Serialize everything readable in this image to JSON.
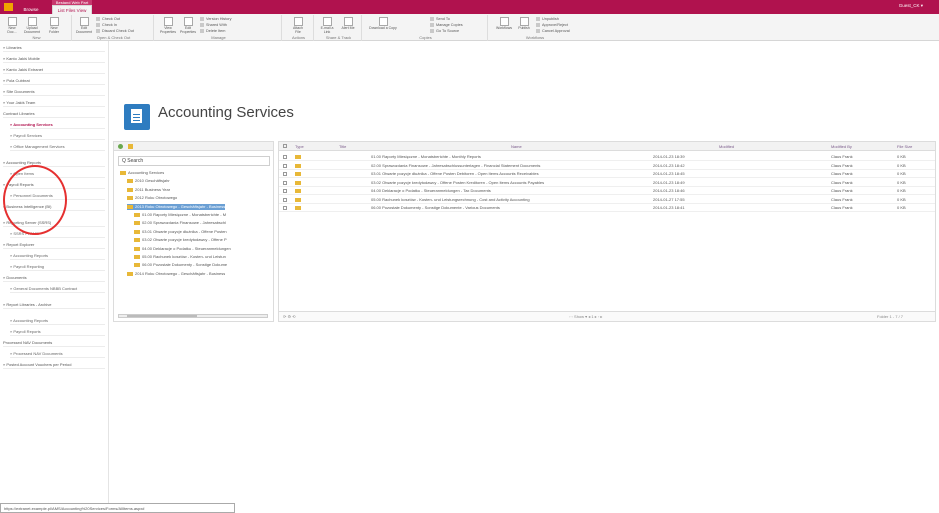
{
  "topbar": {
    "context_tab": "Bestand Web Part",
    "tab_browse": "Browse",
    "tab_list": "List Files View",
    "user": "Guest_CK ▾",
    "accent": "#b0124e"
  },
  "ribbon": {
    "groups": [
      "New",
      "Open & Check Out",
      "Manage",
      "Actions",
      "Share & Track",
      "Copies",
      "Workflows"
    ],
    "new": {
      "new_label": "New Doc...",
      "upload_label": "Upload Document",
      "folder_label": "New Folder"
    },
    "open": {
      "edit_label": "Edit Document",
      "check_out": "Check Out",
      "check_in": "Check In",
      "discard": "Discard Check Out"
    },
    "manage": {
      "view": "View Properties",
      "edit": "Edit Properties",
      "version_history": "Version History",
      "shared_with": "Shared With",
      "delete": "Delete Item"
    },
    "actions": {
      "attach": "Attach File"
    },
    "share": {
      "email": "E-mail a Link",
      "alert": "Alert Me"
    },
    "copies": {
      "download": "Download a Copy",
      "send_to": "Send To",
      "manage_copies": "Manage Copies",
      "go_to_source": "Go To Source"
    },
    "workflows": {
      "workflows": "Workflows",
      "publish": "Publish",
      "unpublish": "Unpublish",
      "approve": "Approve/Reject",
      "cancel": "Cancel Approval"
    }
  },
  "leftnav": {
    "items": [
      {
        "label": "» Libraries",
        "sub": false
      },
      {
        "label": "» Kanto Jakiś Mobile",
        "sub": false
      },
      {
        "label": "» Kanto Jakiś Extranet",
        "sub": false
      },
      {
        "label": "» Pola Cubbrat",
        "sub": false
      },
      {
        "label": "» Site Documents",
        "sub": false
      },
      {
        "label": "» Your Jakiś Team",
        "sub": false
      },
      {
        "label": "Contract Libraries",
        "sub": false
      },
      {
        "label": "» Accounting Services",
        "sub": true,
        "active": true
      },
      {
        "label": "» Payroll Services",
        "sub": true
      },
      {
        "label": "» Office Management Services",
        "sub": true
      },
      {
        "label": "» Accounting Reports",
        "sub": false
      },
      {
        "label": "» Open Items",
        "sub": true
      },
      {
        "label": "» Payroll Reports",
        "sub": false
      },
      {
        "label": "» Personnel Documents",
        "sub": true
      },
      {
        "label": "» Business Intelligence (BI)",
        "sub": false
      },
      {
        "label": "» Reporting Server (SSRS)",
        "sub": false
      },
      {
        "label": "» SSRS PFAME",
        "sub": true
      },
      {
        "label": "» Report Explorer",
        "sub": false
      },
      {
        "label": "» Accounting Reports",
        "sub": true
      },
      {
        "label": "» Payroll Reporting",
        "sub": true
      },
      {
        "label": "» Documents",
        "sub": false
      },
      {
        "label": "» General Documents NBBB Contract",
        "sub": true
      },
      {
        "label": "» Report Libraries - Archive",
        "sub": false
      },
      {
        "label": "» Accounting Reports",
        "sub": true
      },
      {
        "label": "» Payroll Reports",
        "sub": true
      },
      {
        "label": "Processed NAV Documents",
        "sub": false
      },
      {
        "label": "» Processed NAV Documents",
        "sub": true
      },
      {
        "label": "» Posted Account Vouchers per Period",
        "sub": false
      }
    ]
  },
  "header": {
    "title": "Accounting Services"
  },
  "tree": {
    "search_placeholder": "Q Search",
    "nodes": [
      {
        "label": "Accounting Services",
        "level": 0
      },
      {
        "label": "2010 Geschäftsjahr",
        "level": 1
      },
      {
        "label": "2011 Business Year",
        "level": 1
      },
      {
        "label": "2012 Roku Obrotowego",
        "level": 1
      },
      {
        "label": "2013 Roku Obrotowego - Geschäftsjahr - Business",
        "level": 1,
        "selected": true
      },
      {
        "label": "01.00 Raporty Miesięczne - Monatsberichte - M",
        "level": 2
      },
      {
        "label": "02.00 Sprawozdania Finansowe - Jahresabschl",
        "level": 2
      },
      {
        "label": "03.01 Otwarte pozycje dłużnika - Offene Posten",
        "level": 2
      },
      {
        "label": "03.02 Otwarte pozycje kredytodawcy - Offene P",
        "level": 2
      },
      {
        "label": "04.00 Deklaracje o Podatku - Steueranmeldungen",
        "level": 2
      },
      {
        "label": "05.00 Rachunek kosztów - Kosten- und Leistun",
        "level": 2
      },
      {
        "label": "06.00 Pozostałe Dokumenty - Sonstige Dokume",
        "level": 2
      },
      {
        "label": "2014 Roku Obrotowego - Geschäftsjahr - Business",
        "level": 1
      }
    ]
  },
  "grid": {
    "columns": [
      "Type",
      "Title",
      "Name",
      "Modified",
      "Modified By",
      "File Size"
    ],
    "rows": [
      {
        "name": "01.00 Raporty Miesięczne - Monatsberichte - Monthly Reports",
        "modified": "2014-01-23 18:39",
        "by": "Claus Frank",
        "size": "0 KB"
      },
      {
        "name": "02.00 Sprawozdania Finansowe - Jahresabschlussunterlagen - Financial Statement Documents",
        "modified": "2014-01-23 18:42",
        "by": "Claus Frank",
        "size": "0 KB"
      },
      {
        "name": "03.01 Otwarte pozycje dłużnika - Offene Posten Debitoren - Open Items Accounts Receivables",
        "modified": "2014-01-23 18:45",
        "by": "Claus Frank",
        "size": "0 KB"
      },
      {
        "name": "03.02 Otwarte pozycje kredytodawcy - Offene Posten Kreditoren - Open Items Accounts Payables",
        "modified": "2014-01-23 18:49",
        "by": "Claus Frank",
        "size": "0 KB"
      },
      {
        "name": "04.00 Deklaracje o Podatku - Steueranmeldungen - Tax Documents",
        "modified": "2014-01-23 18:46",
        "by": "Claus Frank",
        "size": "0 KB"
      },
      {
        "name": "05.00 Rachunek kosztów - Kosten- und Leistungsrechnung - Cost and Activity Accounting",
        "modified": "2014-01-27 17:55",
        "by": "Claus Frank",
        "size": "0 KB"
      },
      {
        "name": "06.00 Pozostałe Dokumenty - Sonstige Dokumente - Various Documents",
        "modified": "2014-01-23 18:41",
        "by": "Claus Frank",
        "size": "0 KB"
      }
    ],
    "footer": {
      "pager": "◦ ◦ Show ▾ ◂ 1 ▸ ◦ ▸",
      "count": "Folder 1 - 7 / 7"
    }
  },
  "statusbar": {
    "url": "https://extranet.example.pl/AMS/Accounting%20Services/Forms/AllItems.aspx#"
  }
}
